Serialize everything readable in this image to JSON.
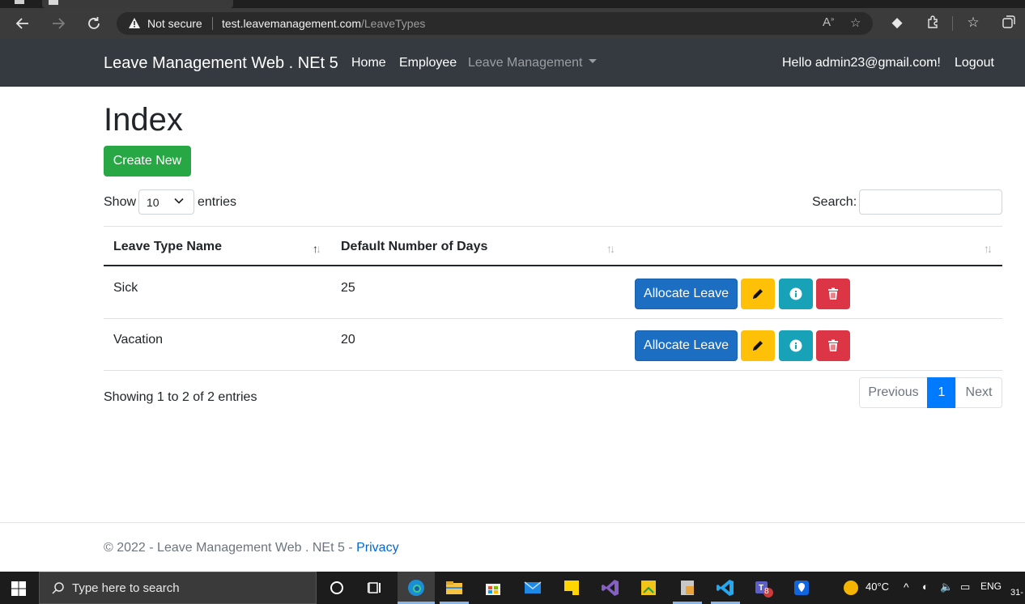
{
  "browser": {
    "security_label": "Not secure",
    "url_host": "test.leavemanagement.com",
    "url_path": "/LeaveTypes"
  },
  "navbar": {
    "brand": "Leave Management Web . NEt 5",
    "links": [
      "Home",
      "Employee",
      "Leave Management"
    ],
    "greeting": "Hello admin23@gmail.com!",
    "logout": "Logout"
  },
  "page": {
    "title": "Index",
    "create_button": "Create New",
    "length": {
      "show": "Show",
      "value": "10",
      "entries": "entries"
    },
    "search_label": "Search:",
    "search_value": ""
  },
  "table": {
    "columns": [
      "Leave Type Name",
      "Default Number of Days",
      ""
    ],
    "rows": [
      {
        "name": "Sick",
        "days": "25",
        "allocate": "Allocate Leave"
      },
      {
        "name": "Vacation",
        "days": "20",
        "allocate": "Allocate Leave"
      }
    ]
  },
  "footer_info": {
    "showing": "Showing 1 to 2 of 2 entries",
    "previous": "Previous",
    "page": "1",
    "next": "Next"
  },
  "footer": {
    "text": "© 2022 - Leave Management Web . NEt 5 - ",
    "privacy": "Privacy"
  },
  "taskbar": {
    "search_placeholder": "Type here to search",
    "weather": "40°C",
    "language": "ENG",
    "teams_badge": "8",
    "date_fragment": "31-"
  },
  "colors": {
    "navbar": "#343a40",
    "create": "#28a745",
    "allocate": "#1b6ec2",
    "edit": "#ffc107",
    "details": "#17a2b8",
    "delete": "#dc3545",
    "pager_active": "#007bff"
  }
}
